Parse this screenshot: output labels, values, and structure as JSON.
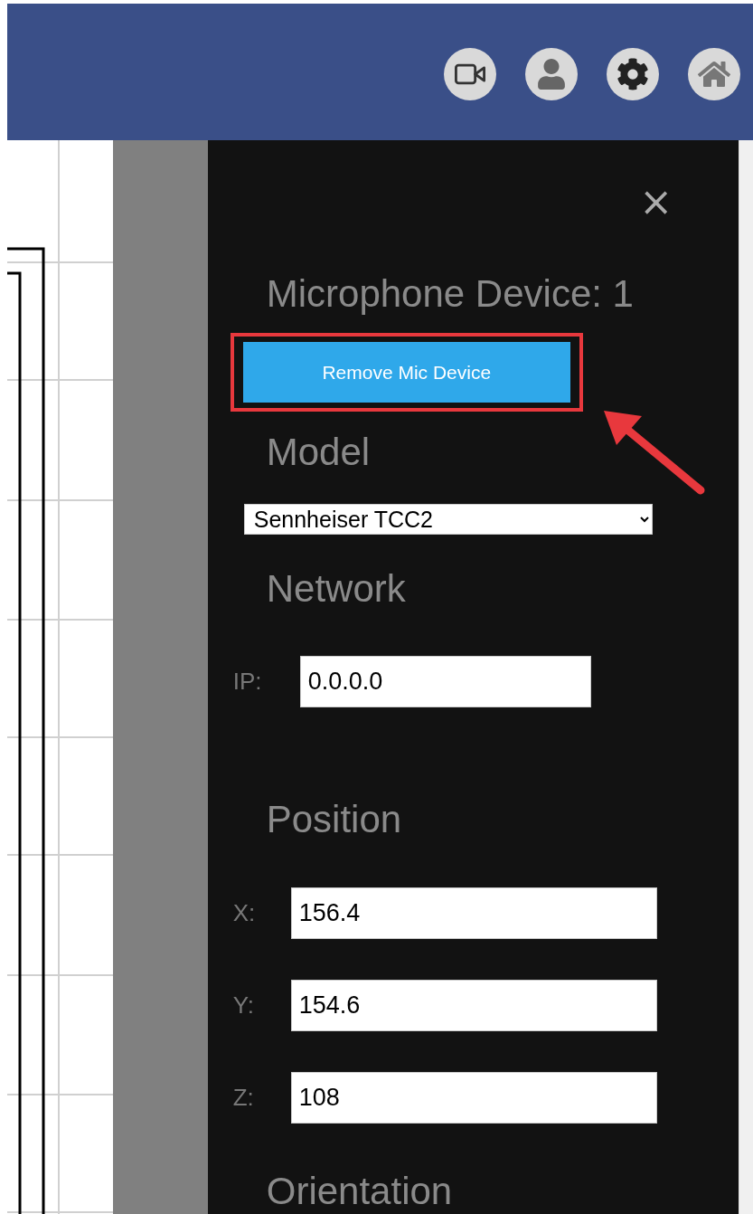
{
  "panel": {
    "close": "×",
    "title": "Microphone Device: 1",
    "remove_button": "Remove Mic Device",
    "highlighted": true,
    "model": {
      "heading": "Model",
      "value": "Sennheiser TCC2"
    },
    "network": {
      "heading": "Network",
      "fields": [
        {
          "label": "IP:",
          "value": "0.0.0.0"
        }
      ]
    },
    "position": {
      "heading": "Position",
      "fields": [
        {
          "label": "X:",
          "value": "156.4"
        },
        {
          "label": "Y:",
          "value": "154.6"
        },
        {
          "label": "Z:",
          "value": "108"
        }
      ]
    },
    "orientation": {
      "heading": "Orientation"
    }
  }
}
